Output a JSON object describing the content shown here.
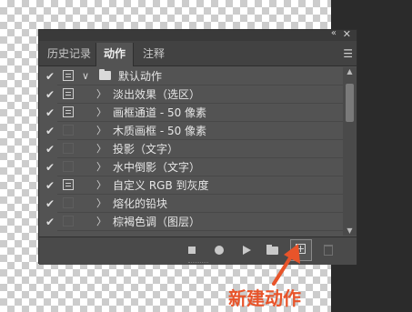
{
  "window": {
    "collapse_glyph": "«",
    "close_glyph": "✕"
  },
  "tabs": [
    {
      "label": "历史记录",
      "active": false
    },
    {
      "label": "动作",
      "active": true
    },
    {
      "label": "注释",
      "active": false
    }
  ],
  "panel_menu_icon": "hamburger-menu-icon",
  "actions": [
    {
      "checked": true,
      "dialog": "on",
      "expanded": true,
      "is_set": true,
      "label": "默认动作"
    },
    {
      "checked": true,
      "dialog": "on",
      "expanded": false,
      "is_set": false,
      "label": "淡出效果（选区）"
    },
    {
      "checked": true,
      "dialog": "on",
      "expanded": false,
      "is_set": false,
      "label": "画框通道 - 50 像素"
    },
    {
      "checked": true,
      "dialog": "off",
      "expanded": false,
      "is_set": false,
      "label": "木质画框 - 50 像素"
    },
    {
      "checked": true,
      "dialog": "off",
      "expanded": false,
      "is_set": false,
      "label": "投影（文字）"
    },
    {
      "checked": true,
      "dialog": "off",
      "expanded": false,
      "is_set": false,
      "label": "水中倒影（文字）"
    },
    {
      "checked": true,
      "dialog": "on",
      "expanded": false,
      "is_set": false,
      "label": "自定义 RGB 到灰度"
    },
    {
      "checked": true,
      "dialog": "off",
      "expanded": false,
      "is_set": false,
      "label": "熔化的铅块"
    },
    {
      "checked": true,
      "dialog": "off",
      "expanded": false,
      "is_set": false,
      "label": "棕褐色调（图层）"
    }
  ],
  "glyphs": {
    "check": "✔",
    "expand_open": "∨",
    "expand_closed": "〉",
    "scroll_up": "▲",
    "scroll_down": "▼"
  },
  "toolbar_buttons": [
    {
      "name": "stop-playing-button",
      "icon": "stop-icon"
    },
    {
      "name": "record-button",
      "icon": "record-icon"
    },
    {
      "name": "play-selection-button",
      "icon": "play-icon"
    },
    {
      "name": "new-set-button",
      "icon": "folder-icon"
    },
    {
      "name": "new-action-button",
      "icon": "new-item-icon"
    },
    {
      "name": "delete-button",
      "icon": "trash-icon"
    }
  ],
  "annotation": {
    "text": "新建动作",
    "color": "#e8542a"
  }
}
